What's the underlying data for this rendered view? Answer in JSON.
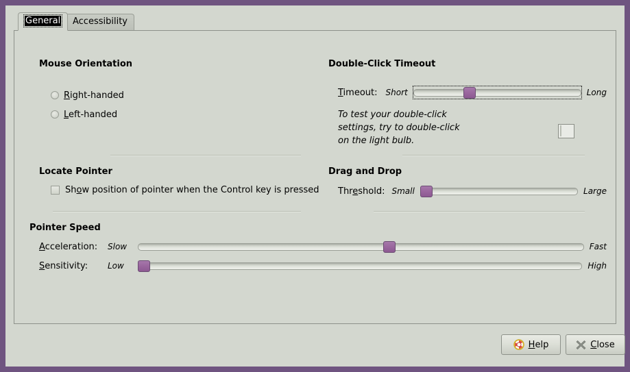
{
  "window": {
    "frame_color": "#6f5480",
    "background_color": "#d3d7cf"
  },
  "tabs": [
    {
      "id": "general",
      "label": "General",
      "selected": true,
      "focused": true
    },
    {
      "id": "accessibility",
      "label": "Accessibility",
      "selected": false,
      "focused": false
    }
  ],
  "sections": {
    "mouse_orientation": {
      "title": "Mouse Orientation",
      "options": [
        {
          "label": "Right-handed",
          "accel": "R",
          "selected": false
        },
        {
          "label": "Left-handed",
          "accel": "L",
          "selected": false
        }
      ]
    },
    "double_click_timeout": {
      "title": "Double-Click Timeout",
      "slider": {
        "name": "Timeout:",
        "accel": "T",
        "min_label": "Short",
        "max_label": "Long",
        "value_percent": 30,
        "focused": true
      },
      "hint": "To test your double-click\nsettings, try to double-click\non the light bulb.",
      "target_icon": "light-bulb-test-icon"
    },
    "locate_pointer": {
      "title": "Locate Pointer",
      "checkbox": {
        "label": "Show position of pointer when the Control key is pressed",
        "accel": "o",
        "checked": false
      }
    },
    "drag_and_drop": {
      "title": "Drag and Drop",
      "slider": {
        "name": "Threshold:",
        "accel": "e",
        "min_label": "Small",
        "max_label": "Large",
        "value_percent": 1,
        "focused": false
      }
    },
    "pointer_speed": {
      "title": "Pointer Speed",
      "sliders": [
        {
          "name": "Acceleration:",
          "accel": "A",
          "min_label": "Slow",
          "max_label": "Fast",
          "value_percent": 55,
          "focused": false
        },
        {
          "name": "Sensitivity:",
          "accel": "S",
          "min_label": "Low",
          "max_label": "High",
          "value_percent": 1,
          "focused": false
        }
      ]
    }
  },
  "footer": {
    "help_label": "Help",
    "help_accel": "H",
    "help_icon": "lifebuoy-icon",
    "close_label": "Close",
    "close_accel": "C",
    "close_icon": "close-x-icon"
  },
  "colors": {
    "slider_handle": "#9b689f",
    "window_border": "#6f5480",
    "panel_background": "#d3d7cf"
  }
}
